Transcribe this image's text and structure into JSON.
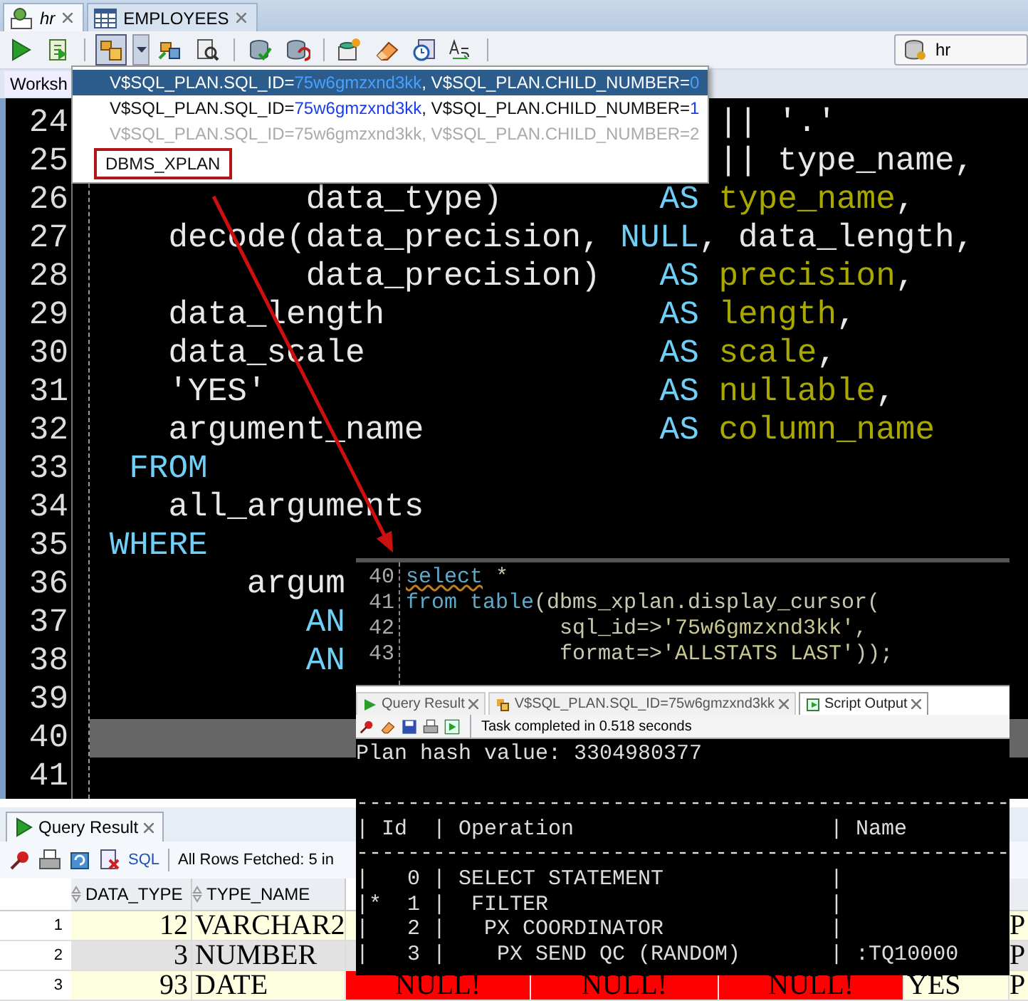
{
  "editor_tabs": [
    {
      "label": "hr",
      "kind": "sql",
      "selected": true
    },
    {
      "label": "EMPLOYEES",
      "kind": "table",
      "selected": false
    }
  ],
  "toolbar": {
    "buttons": [
      {
        "kind": "run",
        "pressed": false
      },
      {
        "kind": "script",
        "pressed": false
      },
      {
        "kind": "plan",
        "pressed": true
      },
      {
        "kind": "autotrace",
        "pressed": false
      },
      {
        "kind": "inspect",
        "pressed": false
      },
      {
        "kind": "commit",
        "pressed": false
      },
      {
        "kind": "rollback",
        "pressed": false
      },
      {
        "kind": "sqlstar",
        "pressed": false
      },
      {
        "kind": "eraser",
        "pressed": false
      },
      {
        "kind": "history",
        "pressed": false
      },
      {
        "kind": "case",
        "pressed": false
      }
    ],
    "connection": "hr"
  },
  "worksheet_tab": {
    "label": "Worksh"
  },
  "editor": {
    "lines": [
      {
        "number": "24",
        "current": false,
        "segments": [
          {
            "text": "                                || '.'",
            "kind": "plain"
          }
        ]
      },
      {
        "number": "25",
        "current": false,
        "segments": [
          {
            "text": "                                || type_name,",
            "kind": "plain"
          }
        ]
      },
      {
        "number": "26",
        "current": false,
        "segments": [
          {
            "text": "           data_type)        ",
            "kind": "plain"
          },
          {
            "text": "AS",
            "kind": "keyword"
          },
          {
            "text": " type_name",
            "kind": "alias"
          },
          {
            "text": ",",
            "kind": "plain"
          }
        ]
      },
      {
        "number": "27",
        "current": false,
        "segments": [
          {
            "text": "    decode(data_precision, ",
            "kind": "plain"
          },
          {
            "text": "NULL",
            "kind": "keyword"
          },
          {
            "text": ", data_length,",
            "kind": "plain"
          }
        ]
      },
      {
        "number": "28",
        "current": false,
        "segments": [
          {
            "text": "           data_precision)   ",
            "kind": "plain"
          },
          {
            "text": "AS",
            "kind": "keyword"
          },
          {
            "text": " precision",
            "kind": "alias"
          },
          {
            "text": ",",
            "kind": "plain"
          }
        ]
      },
      {
        "number": "29",
        "current": false,
        "segments": [
          {
            "text": "    data_length              ",
            "kind": "plain"
          },
          {
            "text": "AS",
            "kind": "keyword"
          },
          {
            "text": " length",
            "kind": "alias"
          },
          {
            "text": ",",
            "kind": "plain"
          }
        ]
      },
      {
        "number": "30",
        "current": false,
        "segments": [
          {
            "text": "    data_scale               ",
            "kind": "plain"
          },
          {
            "text": "AS",
            "kind": "keyword"
          },
          {
            "text": " scale",
            "kind": "alias"
          },
          {
            "text": ",",
            "kind": "plain"
          }
        ]
      },
      {
        "number": "31",
        "current": false,
        "segments": [
          {
            "text": "    'YES'                    ",
            "kind": "plain"
          },
          {
            "text": "AS",
            "kind": "keyword"
          },
          {
            "text": " nullable",
            "kind": "alias"
          },
          {
            "text": ",",
            "kind": "plain"
          }
        ]
      },
      {
        "number": "32",
        "current": false,
        "segments": [
          {
            "text": "    argument_name            ",
            "kind": "plain"
          },
          {
            "text": "AS",
            "kind": "keyword"
          },
          {
            "text": " column_name",
            "kind": "alias"
          }
        ]
      },
      {
        "number": "33",
        "current": false,
        "segments": [
          {
            "text": "  FROM",
            "kind": "keyword"
          }
        ]
      },
      {
        "number": "34",
        "current": false,
        "segments": [
          {
            "text": "    all_arguments",
            "kind": "plain"
          }
        ]
      },
      {
        "number": "35",
        "current": false,
        "segments": [
          {
            "text": " WHERE",
            "kind": "keyword"
          }
        ]
      },
      {
        "number": "36",
        "current": false,
        "segments": [
          {
            "text": "        argum",
            "kind": "plain"
          }
        ]
      },
      {
        "number": "37",
        "current": false,
        "segments": [
          {
            "text": "           AN",
            "kind": "keyword"
          }
        ]
      },
      {
        "number": "38",
        "current": false,
        "segments": [
          {
            "text": "           AN",
            "kind": "keyword"
          }
        ]
      },
      {
        "number": "39",
        "current": false
      },
      {
        "number": "40",
        "current": true
      },
      {
        "number": "41",
        "current": false
      }
    ]
  },
  "plan_menu": {
    "items": [
      {
        "parts": [
          {
            "text": "V$SQL_PLAN.SQL_ID=",
            "kind": "name"
          },
          {
            "text": "75w6gmzxnd3kk",
            "kind": "value"
          },
          {
            "text": ", V$SQL_PLAN.CHILD_NUMBER=",
            "kind": "name"
          },
          {
            "text": "0",
            "kind": "value"
          }
        ],
        "selected": true,
        "disabled": false,
        "outlined": false
      },
      {
        "parts": [
          {
            "text": "V$SQL_PLAN.SQL_ID=",
            "kind": "name"
          },
          {
            "text": "75w6gmzxnd3kk",
            "kind": "value"
          },
          {
            "text": ", V$SQL_PLAN.CHILD_NUMBER=",
            "kind": "name"
          },
          {
            "text": "1",
            "kind": "value"
          }
        ],
        "selected": false,
        "disabled": false,
        "outlined": false
      },
      {
        "parts": [
          {
            "text": "V$SQL_PLAN.SQL_ID=75w6gmzxnd3kk, V$SQL_PLAN.CHILD_NUMBER=2",
            "kind": "name"
          }
        ],
        "selected": false,
        "disabled": true,
        "outlined": false
      },
      {
        "parts": [
          {
            "text": "DBMS_XPLAN",
            "kind": "name"
          }
        ],
        "selected": false,
        "disabled": false,
        "outlined": true
      }
    ]
  },
  "results": {
    "tab": "Query Result",
    "sql_link": "SQL",
    "status": "All Rows Fetched: 5 in",
    "columns": [
      "DATA_TYPE",
      "TYPE_NAME"
    ],
    "rows": [
      {
        "number": "1",
        "cells": [
          {
            "text": "12",
            "null": false
          },
          {
            "text": "VARCHAR2",
            "null": false
          },
          null,
          null,
          null,
          null,
          {
            "text": "P",
            "null": false
          }
        ]
      },
      {
        "number": "2",
        "cells": [
          {
            "text": "3",
            "null": false
          },
          {
            "text": "NUMBER",
            "null": false
          },
          null,
          null,
          null,
          null,
          {
            "text": "P",
            "null": false
          }
        ]
      },
      {
        "number": "3",
        "cells": [
          {
            "text": "93",
            "null": false
          },
          {
            "text": "DATE",
            "null": false
          },
          {
            "text": "NULL!",
            "null": true
          },
          {
            "text": "NULL!",
            "null": true
          },
          {
            "text": "NULL!",
            "null": true
          },
          {
            "text": "YES",
            "null": false
          },
          {
            "text": "P",
            "null": false
          }
        ]
      }
    ]
  },
  "inset": {
    "lines": [
      {
        "number": "40",
        "segments": [
          {
            "text": "select",
            "kind": "keyword_warn"
          },
          {
            "text": " *",
            "kind": "plain"
          }
        ]
      },
      {
        "number": "41",
        "segments": [
          {
            "text": "from table",
            "kind": "keyword"
          },
          {
            "text": "(dbms_xplan.display_cursor(",
            "kind": "plain"
          }
        ]
      },
      {
        "number": "42",
        "segments": [
          {
            "text": "            sql_id=>",
            "kind": "plain"
          },
          {
            "text": "'75w6gmzxnd3kk'",
            "kind": "string"
          },
          {
            "text": ",",
            "kind": "plain"
          }
        ]
      },
      {
        "number": "43",
        "segments": [
          {
            "text": "            format=>",
            "kind": "plain"
          },
          {
            "text": "'ALLSTATS LAST'",
            "kind": "string"
          },
          {
            "text": "));",
            "kind": "plain"
          }
        ]
      }
    ],
    "tabs": [
      {
        "label": "Query Result",
        "kind": "grid",
        "selected": false
      },
      {
        "label": "V$SQL_PLAN.SQL_ID=75w6gmzxnd3kk",
        "kind": "plan",
        "selected": false
      },
      {
        "label": "Script Output",
        "kind": "script",
        "selected": true
      }
    ],
    "status": "Task completed in 0.518 seconds",
    "output": [
      "Plan hash value: 3304980377",
      "---------------------------------------------------",
      "| Id  | Operation                    | Name",
      "---------------------------------------------------",
      "|   0 | SELECT STATEMENT             |",
      "|*  1 |  FILTER                      |",
      "|   2 |   PX COORDINATOR             |",
      "|   3 |    PX SEND QC (RANDOM)       | :TQ10000"
    ]
  }
}
